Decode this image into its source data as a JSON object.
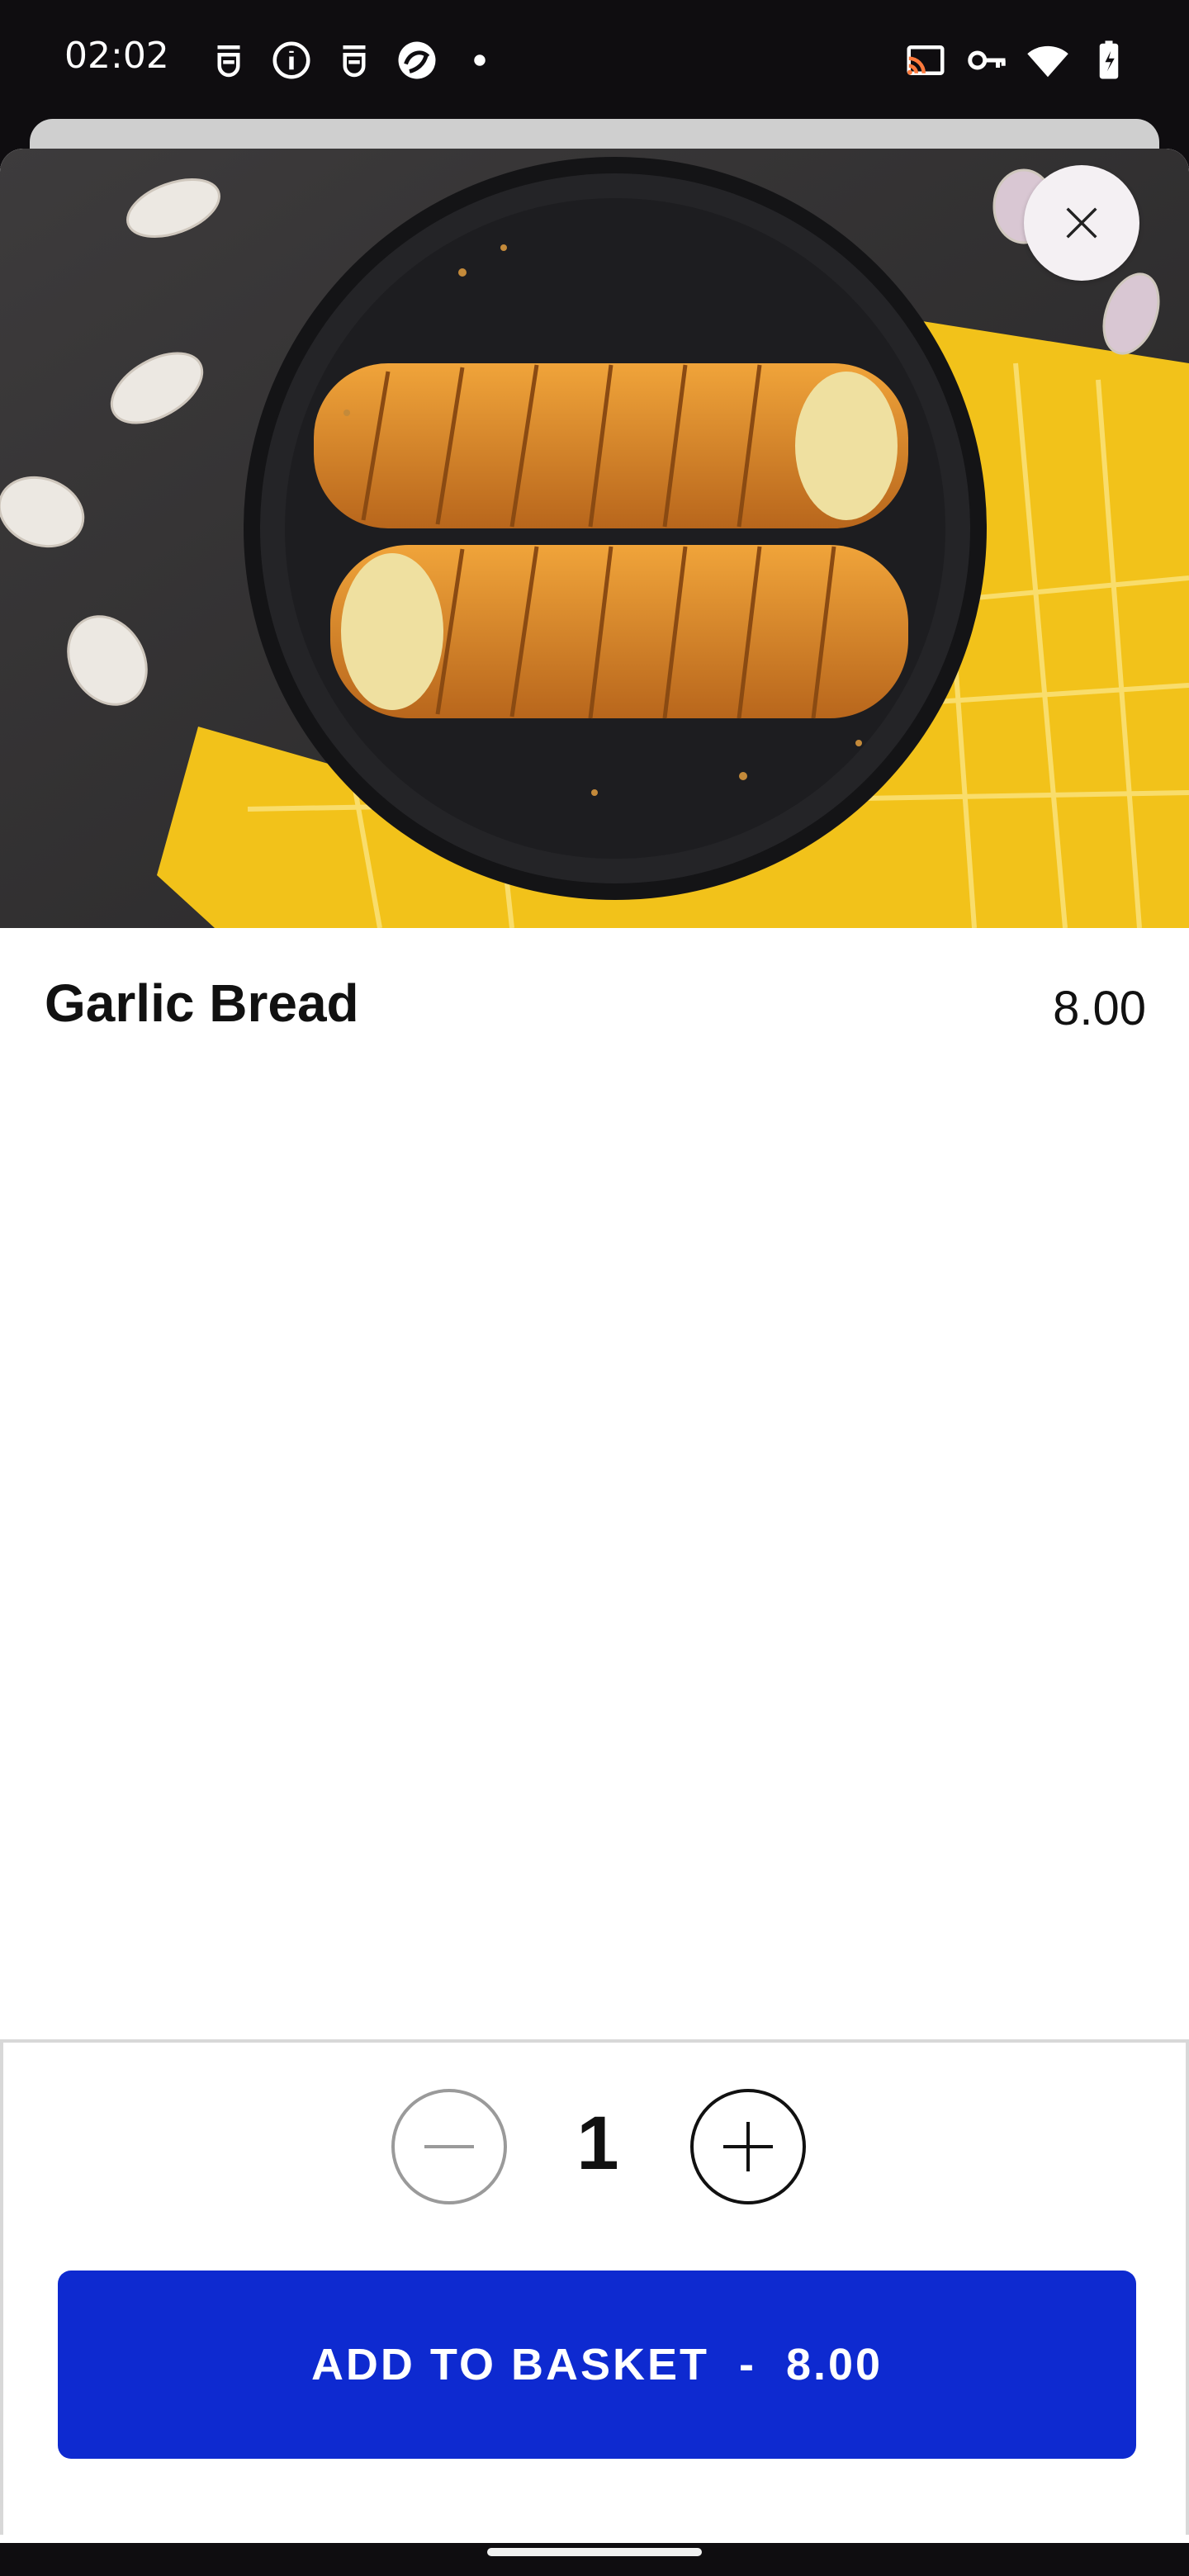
{
  "status_bar": {
    "time": "02:02",
    "left_icons": [
      "assistant-icon",
      "info-icon",
      "assistant-icon-2",
      "camera-app-icon",
      "dot-icon"
    ],
    "right_icons": [
      "cast-icon",
      "vpn-key-icon",
      "wifi-icon",
      "battery-charging-icon"
    ]
  },
  "item": {
    "name": "Garlic Bread",
    "price": "8.00"
  },
  "footer": {
    "quantity": "1",
    "add_label": "ADD TO BASKET",
    "separator": "-",
    "total": "8.00"
  },
  "colors": {
    "accent": "#0e2ad0",
    "status_bar_bg": "#0f0d10"
  }
}
